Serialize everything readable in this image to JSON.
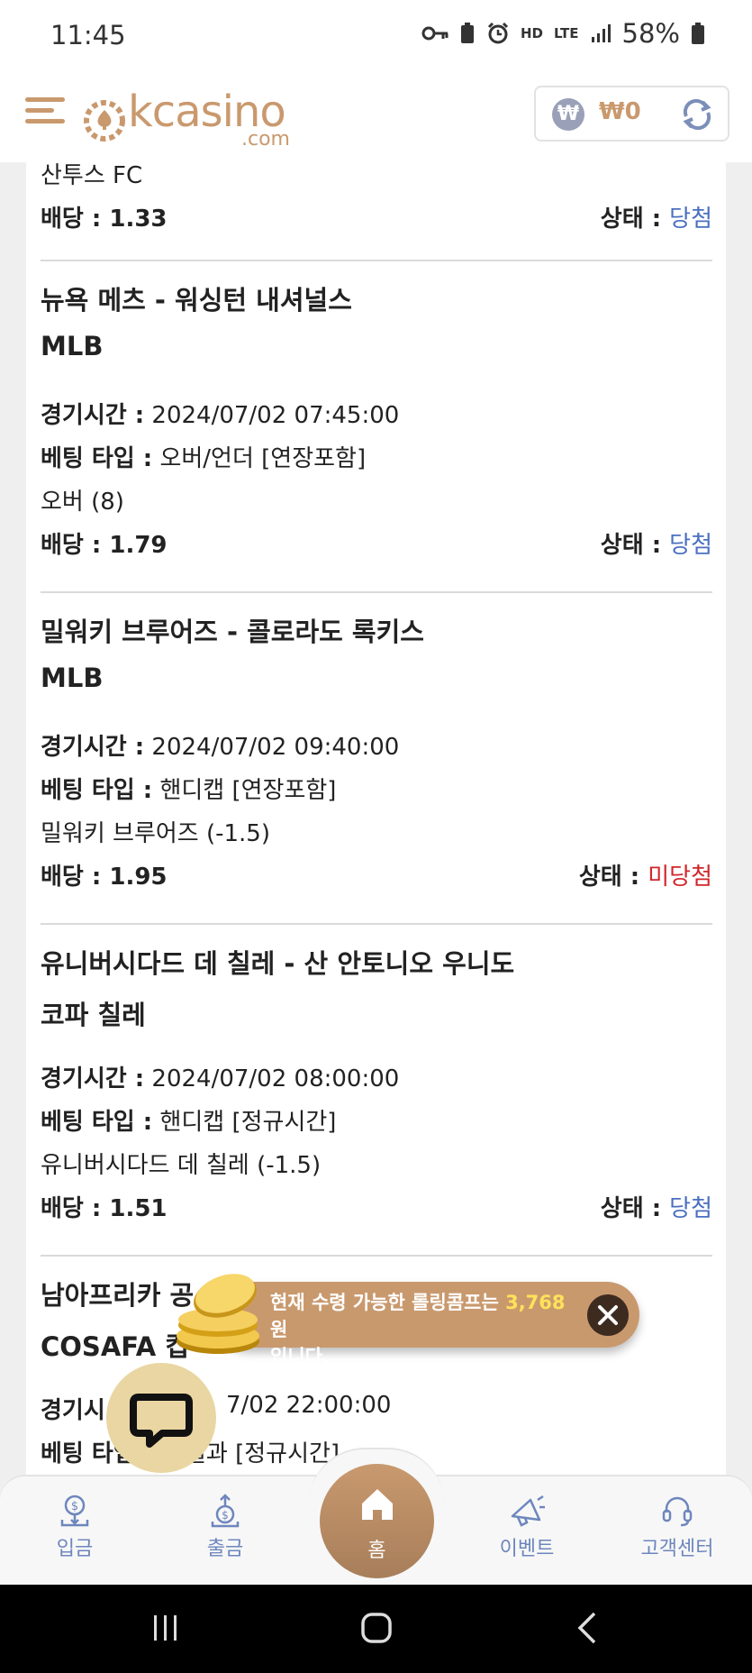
{
  "status_bar": {
    "time": "11:45",
    "network_hd": "HD",
    "network_lte": "LTE",
    "battery": "58%"
  },
  "header": {
    "logo_text": "kcasino",
    "logo_sub": ".com",
    "wallet": {
      "currency_symbol": "₩",
      "amount": "₩0"
    }
  },
  "bets": [
    {
      "selection": "산투스 FC",
      "odds_label": "배당 :",
      "odds": "1.33",
      "status_label": "상태 :",
      "status": "당첨"
    },
    {
      "title": "뉴욕 메츠 - 워싱턴 내셔널스",
      "league": "MLB",
      "time_label": "경기시간 :",
      "time": "2024/07/02 07:45:00",
      "type_label": "베팅 타입 :",
      "type": "오버/언더 [연장포함]",
      "selection": "오버 (8)",
      "odds_label": "배당 :",
      "odds": "1.79",
      "status_label": "상태 :",
      "status": "당첨"
    },
    {
      "title": "밀워키 브루어즈 - 콜로라도 록키스",
      "league": "MLB",
      "time_label": "경기시간 :",
      "time": "2024/07/02 09:40:00",
      "type_label": "베팅 타입 :",
      "type": "핸디캡 [연장포함]",
      "selection": "밀워키 브루어즈 (-1.5)",
      "odds_label": "배당 :",
      "odds": "1.95",
      "status_label": "상태 :",
      "status": "미당첨"
    },
    {
      "title": "유니버시다드 데 칠레 - 산 안토니오 우니도",
      "league": "코파 칠레",
      "time_label": "경기시간 :",
      "time": "2024/07/02 08:00:00",
      "type_label": "베팅 타입 :",
      "type": "핸디캡 [정규시간]",
      "selection": "유니버시다드 데 칠레 (-1.5)",
      "odds_label": "배당 :",
      "odds": "1.51",
      "status_label": "상태 :",
      "status": "당첨"
    },
    {
      "title_partial": "남아프리카 공",
      "league": "COSAFA 컵",
      "time_label_partial": "경기시",
      "time_partial": "7/02 22:00:00",
      "type_label_partial": "베팅 타입",
      "type_partial": "결과 [정규시간]"
    }
  ],
  "toast": {
    "text_before": "현재 수령 가능한 롤링콤프는",
    "amount": "3,768",
    "text_unit": "원",
    "text_after": "입니다."
  },
  "bottom_nav": {
    "deposit": "입금",
    "withdraw": "출금",
    "home": "홈",
    "event": "이벤트",
    "support": "고객센터"
  },
  "colors": {
    "brand": "#c9996e",
    "win": "#4a6fc1",
    "lose": "#d2262b",
    "nav": "#6d86bd"
  }
}
